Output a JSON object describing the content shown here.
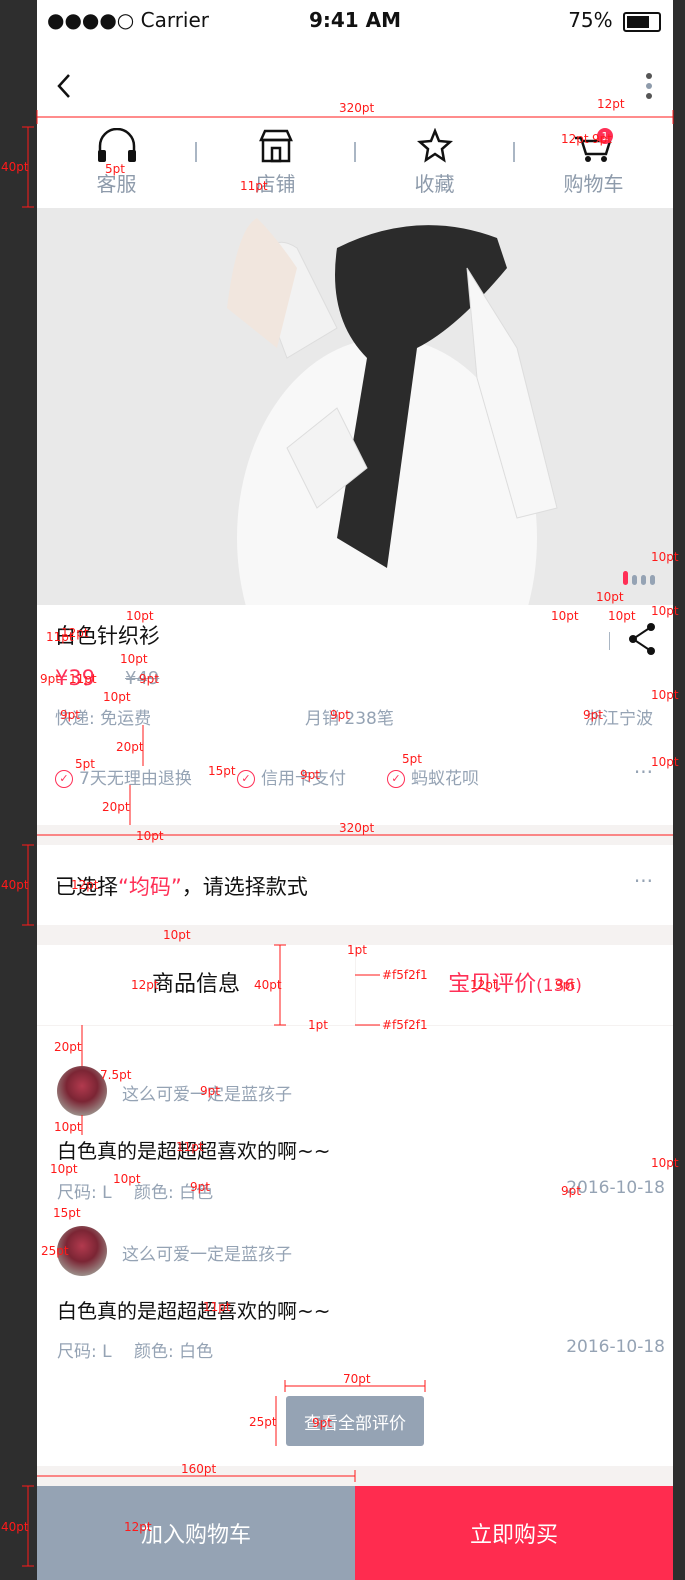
{
  "status": {
    "carrier": "●●●●○ Carrier",
    "time": "9:41 AM",
    "battery": "75%"
  },
  "quick": {
    "service": "客服",
    "shop": "店铺",
    "fav": "收藏",
    "cart": "购物车",
    "cart_badge": "1"
  },
  "product": {
    "title": "白色针织衫",
    "price": "¥39",
    "old_price": "¥49",
    "shipping": "快递: 免运费",
    "sales": "月销 238笔",
    "location": "浙江宁波"
  },
  "services": {
    "s1": "7天无理由退换",
    "s2": "信用卡支付",
    "s3": "蚂蚁花呗",
    "more": "···"
  },
  "select": {
    "prefix": "已选择",
    "value": "“均码”",
    "suffix": "，请选择款式",
    "more": "···"
  },
  "tabs": {
    "info": "商品信息",
    "reviews": "宝贝评价",
    "count": "(136)"
  },
  "reviews": [
    {
      "nick": "这么可爱一定是蓝孩子",
      "text": "白色真的是超超超喜欢的啊~~",
      "size": "尺码: L",
      "color": "颜色: 白色",
      "date": "2016-10-18"
    },
    {
      "nick": "这么可爱一定是蓝孩子",
      "text": "白色真的是超超超喜欢的啊~~",
      "size": "尺码: L",
      "color": "颜色: 白色",
      "date": "2016-10-18"
    }
  ],
  "more_reviews": "查看全部评价",
  "bottom": {
    "add_cart": "加入购物车",
    "buy": "立即购买"
  },
  "annotations": [
    "320pt",
    "12pt",
    "40pt",
    "5pt",
    "11pt",
    "12pt",
    "9pt",
    "10pt",
    "10pt",
    "10pt",
    "10pt",
    "10pt",
    "12pt",
    "11pt",
    "9pt",
    "9pt",
    "10pt",
    "9pt",
    "9pt",
    "10pt",
    "20pt",
    "5pt",
    "15pt",
    "5pt",
    "9pt",
    "20pt",
    "10pt",
    "10pt",
    "320pt",
    "40pt",
    "12pt",
    "10pt",
    "1pt",
    "12pt",
    "40pt",
    "12pt",
    "9pt",
    "1pt",
    "20pt",
    "7.5pt",
    "9pt",
    "10pt",
    "11pt",
    "10pt",
    "10pt",
    "9pt",
    "9pt",
    "10pt",
    "15pt",
    "25pt",
    "11pt",
    "70pt",
    "25pt",
    "9pt",
    "160pt",
    "40pt",
    "12pt"
  ],
  "colors": {
    "accent": "#ff2f56",
    "grey": "#95a3b4",
    "divider": "#f5f2f1",
    "divider_label": "#f5f2f1"
  }
}
